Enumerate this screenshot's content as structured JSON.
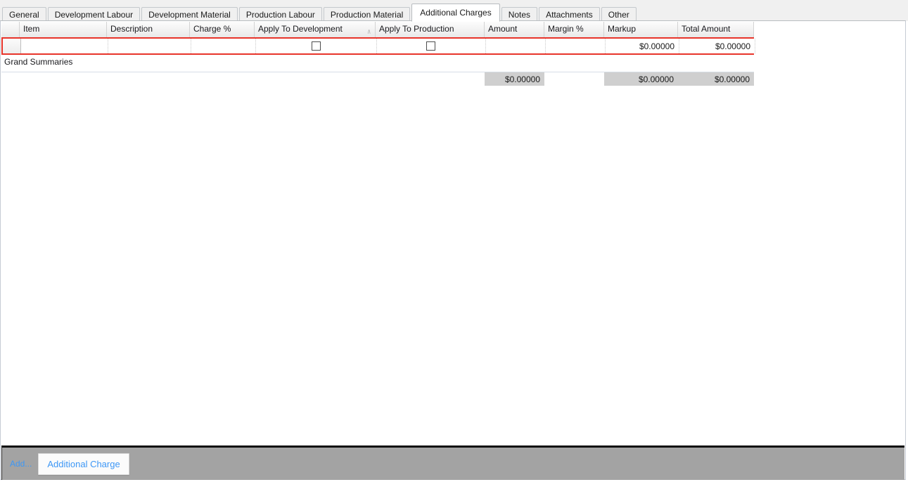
{
  "tabs": [
    {
      "label": "General",
      "selected": false
    },
    {
      "label": "Development Labour",
      "selected": false
    },
    {
      "label": "Development Material",
      "selected": false
    },
    {
      "label": "Production Labour",
      "selected": false
    },
    {
      "label": "Production Material",
      "selected": false
    },
    {
      "label": "Additional Charges",
      "selected": true
    },
    {
      "label": "Notes",
      "selected": false
    },
    {
      "label": "Attachments",
      "selected": false
    },
    {
      "label": "Other",
      "selected": false
    }
  ],
  "grid": {
    "columns": [
      {
        "label": "",
        "width": 26,
        "type": "rowheader"
      },
      {
        "label": "Item",
        "width": 124,
        "type": "text"
      },
      {
        "label": "Description",
        "width": 118,
        "type": "text"
      },
      {
        "label": "Charge %",
        "width": 92,
        "type": "text"
      },
      {
        "label": "Apply To Development",
        "width": 172,
        "type": "check",
        "sorted": true
      },
      {
        "label": "Apply To Production",
        "width": 155,
        "type": "check"
      },
      {
        "label": "Amount",
        "width": 85,
        "type": "number"
      },
      {
        "label": "Margin %",
        "width": 85,
        "type": "number"
      },
      {
        "label": "Markup",
        "width": 105,
        "type": "number"
      },
      {
        "label": "Total Amount",
        "width": 108,
        "type": "number"
      }
    ],
    "sort_indicator": "∧",
    "rows": [
      {
        "selected": true,
        "item": "",
        "description": "",
        "charge_percent": "",
        "apply_to_development": false,
        "apply_to_production": false,
        "amount": "",
        "margin_percent": "",
        "markup": "$0.00000",
        "total_amount": "$0.00000"
      }
    ],
    "group_caption": "Grand Summaries",
    "totals": {
      "item": "",
      "description": "",
      "charge_percent": "",
      "apply_to_development": "",
      "apply_to_production": "",
      "amount": "$0.00000",
      "margin_percent": "",
      "markup": "$0.00000",
      "total_amount": "$0.00000"
    }
  },
  "actionbar": {
    "add_label": "Add...",
    "add_button_label": "Additional Charge"
  },
  "colors": {
    "highlight_border": "#e8342a",
    "link_blue": "#3d97f5",
    "actionbar_bg": "#a3a3a3",
    "summary_fill": "#cfcfcf"
  }
}
